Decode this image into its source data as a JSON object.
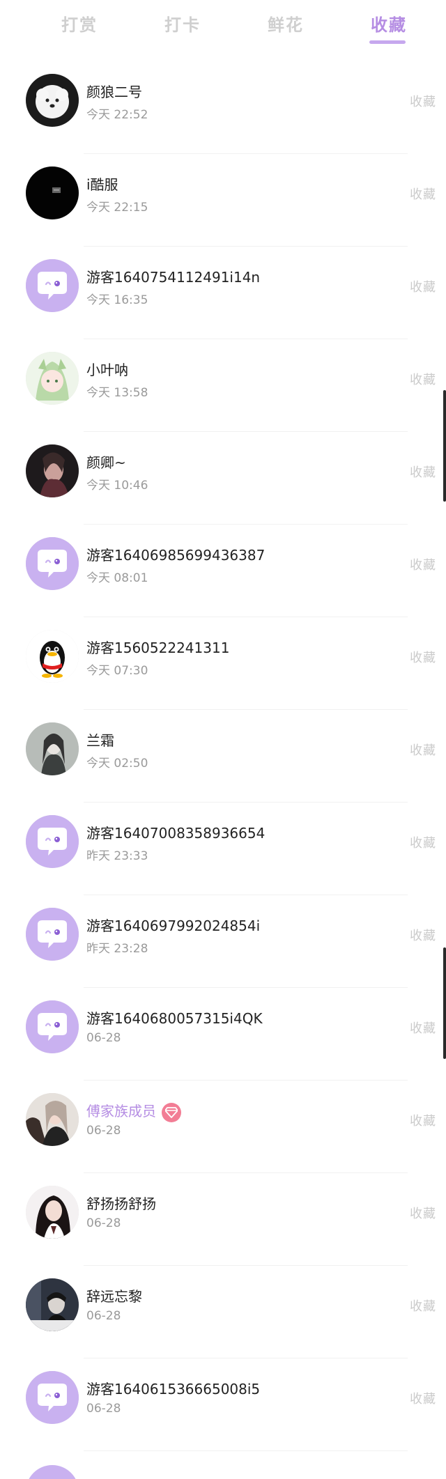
{
  "tabs": [
    {
      "label": "打赏",
      "active": false
    },
    {
      "label": "打卡",
      "active": false
    },
    {
      "label": "鲜花",
      "active": false
    },
    {
      "label": "收藏",
      "active": true
    }
  ],
  "action_label": "收藏",
  "items": [
    {
      "name": "颜狼二号",
      "time": "今天 22:52",
      "avatar": "dog"
    },
    {
      "name": "i酷服",
      "time": "今天 22:15",
      "avatar": "dark"
    },
    {
      "name": "游客1640754112491i14n",
      "time": "今天 16:35",
      "avatar": "default"
    },
    {
      "name": "小叶呐",
      "time": "今天 13:58",
      "avatar": "anime"
    },
    {
      "name": "颜卿~",
      "time": "今天 10:46",
      "avatar": "photo-dark"
    },
    {
      "name": "游客16406985699436387",
      "time": "今天 08:01",
      "avatar": "default"
    },
    {
      "name": "游客1560522241311",
      "time": "今天 07:30",
      "avatar": "penguin"
    },
    {
      "name": "兰霜",
      "time": "今天 02:50",
      "avatar": "photo-gray"
    },
    {
      "name": "游客16407008358936654",
      "time": "昨天 23:33",
      "avatar": "default"
    },
    {
      "name": "游客1640697992024854i",
      "time": "昨天 23:28",
      "avatar": "default"
    },
    {
      "name": "游客1640680057315i4QK",
      "time": "06-28",
      "avatar": "default"
    },
    {
      "name": "傅家族成员",
      "time": "06-28",
      "avatar": "photo-girl",
      "vip": true
    },
    {
      "name": "舒扬扬舒扬",
      "time": "06-28",
      "avatar": "photo-girl2"
    },
    {
      "name": "辞远忘黎",
      "time": "06-28",
      "avatar": "photo-boy"
    },
    {
      "name": "游客1640615366650​08i5",
      "time": "06-28",
      "avatar": "default"
    }
  ],
  "colors": {
    "accent": "#b58de3",
    "default_avatar_bg": "#c9b1f0",
    "vip_badge": "#f27d95"
  }
}
